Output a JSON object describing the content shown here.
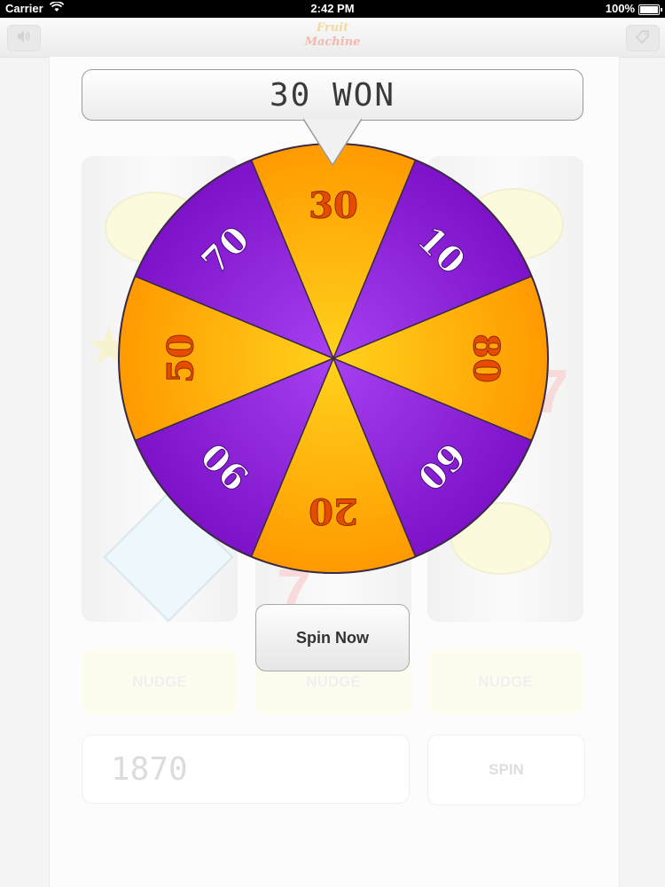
{
  "status": {
    "carrier": "Carrier",
    "time": "2:42 PM",
    "battery": "100%"
  },
  "nav": {
    "logo_line1": "Fruit",
    "logo_line2": "Machine"
  },
  "popup": {
    "won_text": "30 WON",
    "spin_now_label": "Spin Now",
    "wheel": {
      "segments": [
        {
          "label": "30",
          "color": "orange"
        },
        {
          "label": "10",
          "color": "purple"
        },
        {
          "label": "80",
          "color": "orange"
        },
        {
          "label": "60",
          "color": "purple"
        },
        {
          "label": "20",
          "color": "orange"
        },
        {
          "label": "90",
          "color": "purple"
        },
        {
          "label": "50",
          "color": "orange"
        },
        {
          "label": "70",
          "color": "purple"
        }
      ],
      "colors": {
        "orange": "#ff9a00",
        "orange_center": "#ffd21c",
        "purple": "#7d12c8",
        "purple_center": "#a640f0",
        "label_orange": "#e84a00",
        "label_purple": "#ffffff"
      }
    }
  },
  "game": {
    "nudge_labels": [
      "NUDGE",
      "NUDGE",
      "NUDGE"
    ],
    "credits": "1870",
    "spin_label": "SPIN"
  },
  "icons": {
    "sound": "speaker-icon",
    "tag": "tag-icon",
    "wifi": "wifi-icon",
    "pointer": "pointer-arrow-icon"
  }
}
